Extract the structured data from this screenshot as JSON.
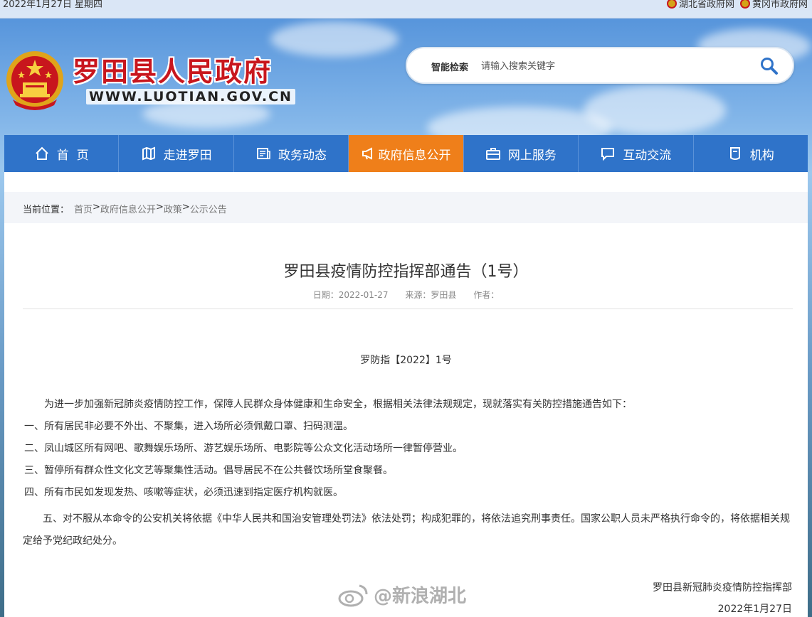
{
  "topbar": {
    "date": "2022年1月27日 星期四",
    "links": [
      "湖北省政府网",
      "黄冈市政府网"
    ]
  },
  "header": {
    "site_title": "罗田县人民政府",
    "site_url": "WWW.LUOTIAN.GOV.CN",
    "search_label": "智能检索",
    "search_placeholder": "请输入搜索关键字"
  },
  "nav": {
    "items": [
      {
        "label": "首  页",
        "icon": "home-icon"
      },
      {
        "label": "走进罗田",
        "icon": "map-icon"
      },
      {
        "label": "政务动态",
        "icon": "news-icon"
      },
      {
        "label": "政府信息公开",
        "icon": "megaphone-icon",
        "active": true
      },
      {
        "label": "网上服务",
        "icon": "briefcase-icon"
      },
      {
        "label": "互动交流",
        "icon": "chat-icon"
      },
      {
        "label": "机构",
        "icon": "building-icon"
      }
    ]
  },
  "breadcrumb": {
    "current_label": "当前位置：",
    "items": [
      "首页",
      "政府信息公开",
      "政策",
      "公示公告"
    ],
    "separator": ">"
  },
  "article": {
    "title": "罗田县疫情防控指挥部通告（1号）",
    "date": "日期：2022-01-27",
    "source": "来源：罗田县",
    "author": "作者：",
    "doc_number": "罗防指【2022】1号",
    "paragraphs": [
      "为进一步加强新冠肺炎疫情防控工作，保障人民群众身体健康和生命安全，根据相关法律法规规定，现就落实有关防控措施通告如下：",
      "一、所有居民非必要不外出、不聚集，进入场所必须佩戴口罩、扫码测温。",
      "二、凤山城区所有网吧、歌舞娱乐场所、游艺娱乐场所、电影院等公众文化活动场所一律暂停营业。",
      "三、暂停所有群众性文化文艺等聚集性活动。倡导居民不在公共餐饮场所堂食聚餐。",
      "四、所有市民如发现发热、咳嗽等症状，必须迅速到指定医疗机构就医。",
      "五、对不服从本命令的公安机关将依据《中华人民共和国治安管理处罚法》依法处罚；构成犯罪的，将依法追究刑事责任。国家公职人员未严格执行命令的，将依据相关规定给予党纪政纪处分。"
    ],
    "signer": "罗田县新冠肺炎疫情防控指挥部",
    "sign_date": "2022年1月27日"
  },
  "watermark": "@新浪湖北",
  "colors": {
    "nav_bg": "#2f73c9",
    "nav_active": "#ef7f1a",
    "title_red": "#c8161d"
  }
}
